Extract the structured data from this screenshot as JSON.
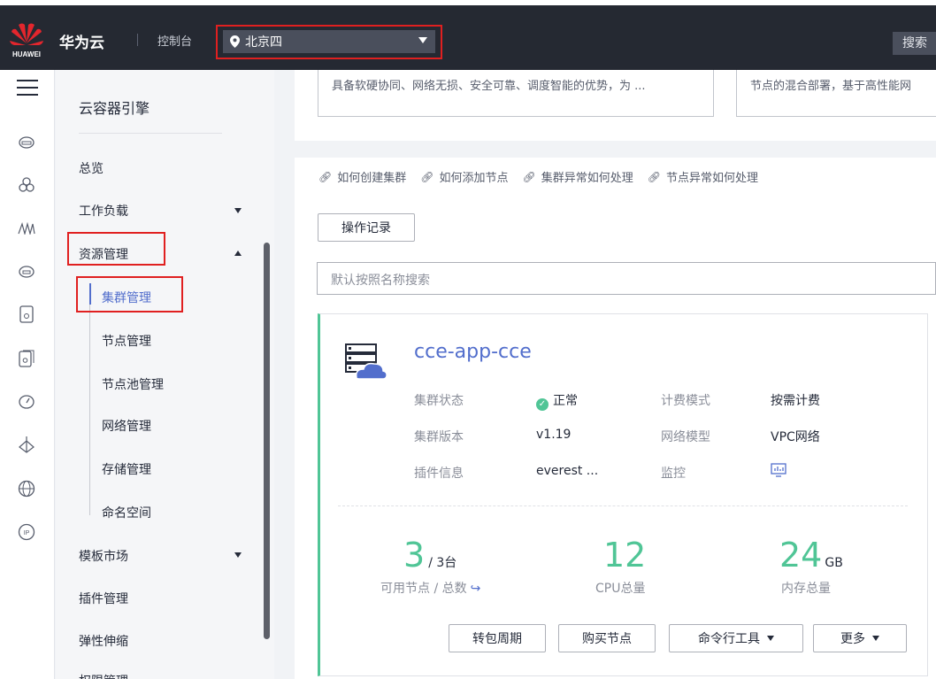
{
  "topbar": {
    "logo_text": "HUAWEI",
    "brand": "华为云",
    "console": "控制台",
    "region": "北京四",
    "search": "搜索"
  },
  "rail": {
    "icons": [
      "menu-icon",
      "cloud-server-icon",
      "cluster-icon",
      "monitor-wave-icon",
      "cloud-icon",
      "storage-icon",
      "storage-2-icon",
      "speed-icon",
      "network-icon",
      "globe-icon",
      "ip-icon"
    ]
  },
  "sidebar": {
    "service_title": "云容器引擎",
    "items": {
      "overview": "总览",
      "workload": "工作负载",
      "resource": "资源管理",
      "cluster": "集群管理",
      "node": "节点管理",
      "nodepool": "节点池管理",
      "network": "网络管理",
      "storage": "存储管理",
      "namespace": "命名空间",
      "template": "模板市场",
      "addon": "插件管理",
      "autoscale": "弹性伸缩",
      "permission": "权限管理"
    }
  },
  "intro": {
    "card1": "具备软硬协同、网络无损、安全可靠、调度智能的优势，为 ...",
    "card2": "节点的混合部署，基于高性能网"
  },
  "help": {
    "links": [
      "如何创建集群",
      "如何添加节点",
      "集群异常如何处理",
      "节点异常如何处理"
    ]
  },
  "toolbar": {
    "oplog": "操作记录",
    "search_placeholder": "默认按照名称搜索"
  },
  "cluster": {
    "name": "cce-app-cce",
    "status_label": "集群状态",
    "status_value": "正常",
    "billing_label": "计费模式",
    "billing_value": "按需计费",
    "version_label": "集群版本",
    "version_value": "v1.19",
    "netmodel_label": "网络模型",
    "netmodel_value": "VPC网络",
    "addon_label": "插件信息",
    "addon_value": "everest ...",
    "monitor_label": "监控",
    "nodes_available": "3",
    "nodes_total": "/ 3台",
    "nodes_label": "可用节点 / 总数",
    "cpu_value": "12",
    "cpu_label": "CPU总量",
    "mem_value": "24",
    "mem_unit": "GB",
    "mem_label": "内存总量",
    "colors": {
      "accent": "#50c596",
      "link": "#526ecc"
    }
  },
  "actions": {
    "to_yearly": "转包周期",
    "buy_node": "购买节点",
    "cli": "命令行工具",
    "more": "更多"
  }
}
